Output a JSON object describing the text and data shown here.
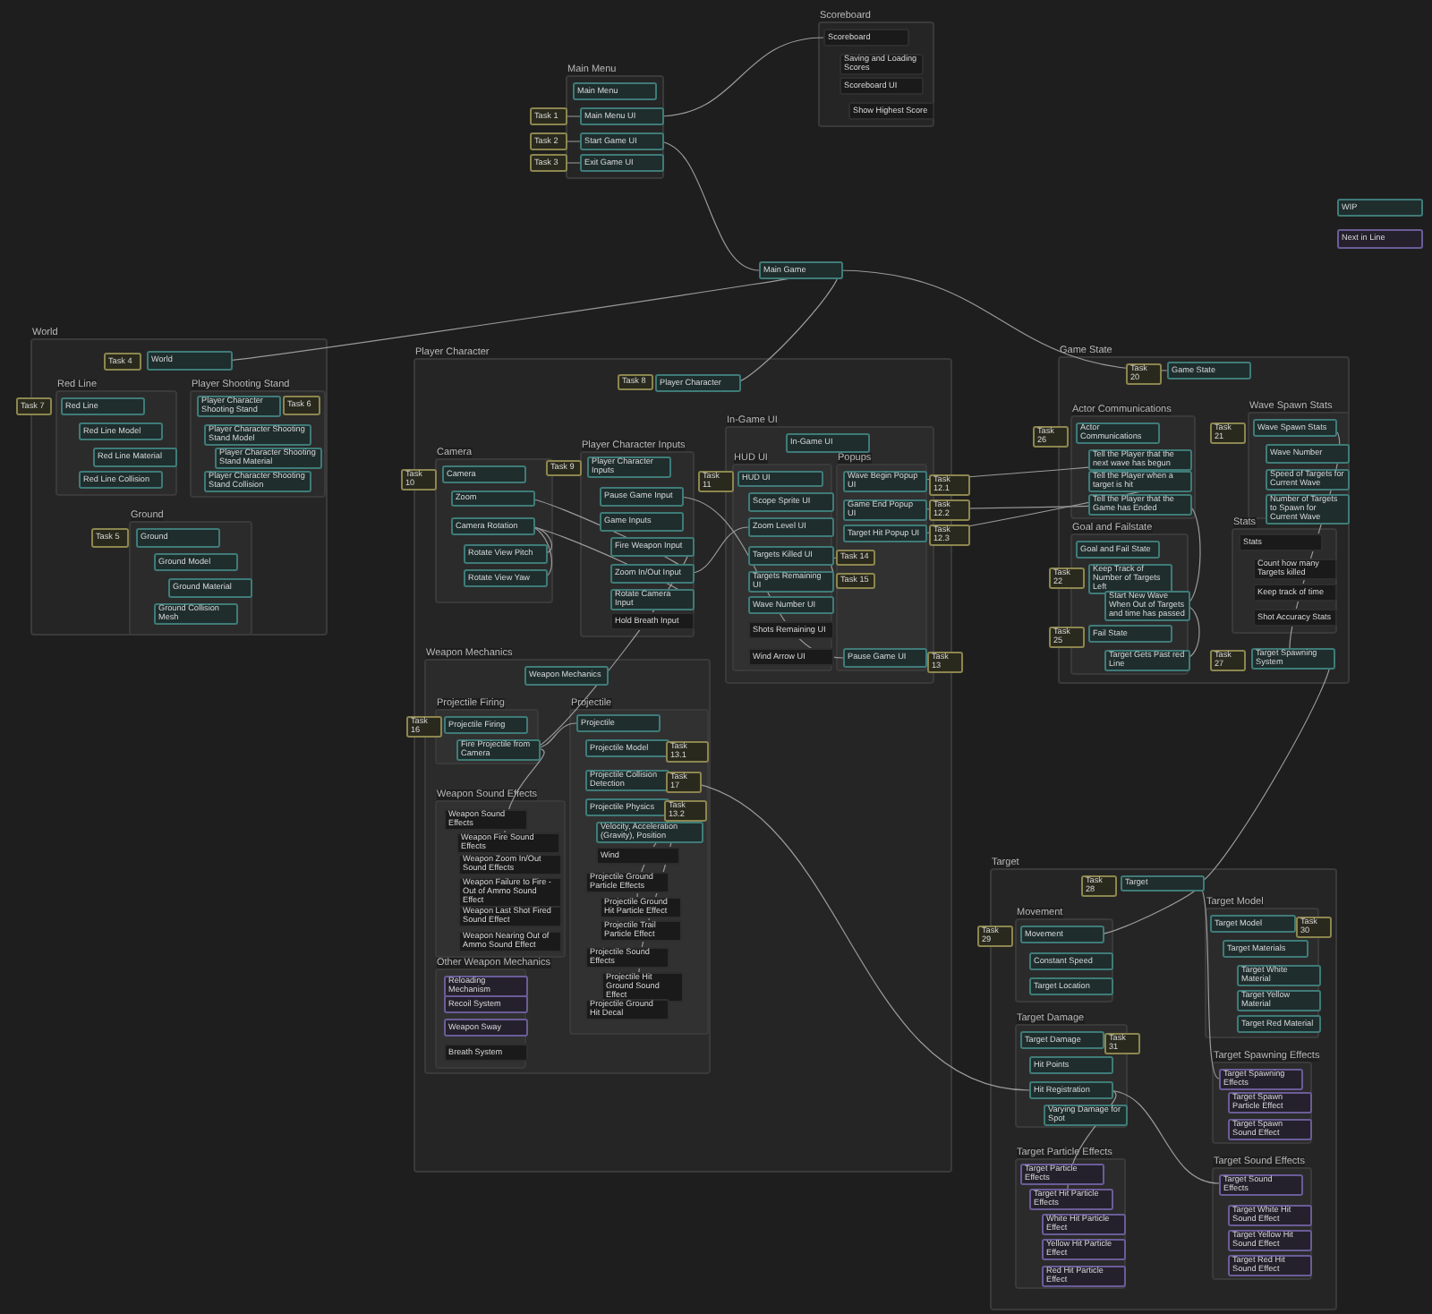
{
  "frames": [
    {
      "title": "Scoreboard"
    },
    {
      "title": "Main Menu"
    },
    {
      "title": "World"
    },
    {
      "title": "Red Line"
    },
    {
      "title": "Player Shooting Stand"
    },
    {
      "title": "Ground"
    },
    {
      "title": "Player Character"
    },
    {
      "title": "Camera"
    },
    {
      "title": "Player Character Inputs"
    },
    {
      "title": "In-Game UI"
    },
    {
      "title": "HUD UI"
    },
    {
      "title": "Popups"
    },
    {
      "title": "Weapon Mechanics"
    },
    {
      "title": "Projectile Firing"
    },
    {
      "title": "Weapon Sound Effects"
    },
    {
      "title": "Other Weapon Mechanics"
    },
    {
      "title": "Projectile"
    },
    {
      "title": "Game State"
    },
    {
      "title": "Actor Communications"
    },
    {
      "title": "Goal and Failstate"
    },
    {
      "title": "Wave Spawn Stats"
    },
    {
      "title": "Stats"
    },
    {
      "title": "Target"
    },
    {
      "title": "Movement"
    },
    {
      "title": "Target Model"
    },
    {
      "title": "Target Damage"
    },
    {
      "title": "Target Spawning Effects"
    },
    {
      "title": "Target Particle Effects"
    },
    {
      "title": "Target Sound Effects"
    }
  ],
  "nodes": [
    {
      "label": "Scoreboard",
      "kind": "todo"
    },
    {
      "label": "Saving and Loading Scores",
      "kind": "todo"
    },
    {
      "label": "Scoreboard UI",
      "kind": "todo"
    },
    {
      "label": "Show Highest Score",
      "kind": "todo"
    },
    {
      "label": "Main Menu",
      "kind": "wip"
    },
    {
      "label": "Task 1",
      "kind": "task"
    },
    {
      "label": "Main Menu UI",
      "kind": "wip"
    },
    {
      "label": "Task 2",
      "kind": "task"
    },
    {
      "label": "Start Game UI",
      "kind": "wip"
    },
    {
      "label": "Task 3",
      "kind": "task"
    },
    {
      "label": "Exit Game UI",
      "kind": "wip"
    },
    {
      "label": "WIP",
      "kind": "wip"
    },
    {
      "label": "Next in Line",
      "kind": "next"
    },
    {
      "label": "Main Game",
      "kind": "wip"
    },
    {
      "label": "Task 4",
      "kind": "task"
    },
    {
      "label": "World",
      "kind": "wip"
    },
    {
      "label": "Task 7",
      "kind": "task"
    },
    {
      "label": "Red Line",
      "kind": "wip"
    },
    {
      "label": "Red Line Model",
      "kind": "wip"
    },
    {
      "label": "Red Line Material",
      "kind": "wip"
    },
    {
      "label": "Red Line Collision",
      "kind": "wip"
    },
    {
      "label": "Player Character Shooting Stand",
      "kind": "wip"
    },
    {
      "label": "Task 6",
      "kind": "task"
    },
    {
      "label": "Player Character Shooting Stand Model",
      "kind": "wip"
    },
    {
      "label": "Player Character Shooting Stand Material",
      "kind": "wip"
    },
    {
      "label": "Player Character Shooting Stand Collision",
      "kind": "wip"
    },
    {
      "label": "Task 5",
      "kind": "task"
    },
    {
      "label": "Ground",
      "kind": "wip"
    },
    {
      "label": "Ground Model",
      "kind": "wip"
    },
    {
      "label": "Ground Material",
      "kind": "wip"
    },
    {
      "label": "Ground Collision Mesh",
      "kind": "wip"
    },
    {
      "label": "Task 8",
      "kind": "task"
    },
    {
      "label": "Player Character",
      "kind": "wip"
    },
    {
      "label": "Task 10",
      "kind": "task"
    },
    {
      "label": "Camera",
      "kind": "wip"
    },
    {
      "label": "Task 9",
      "kind": "task"
    },
    {
      "label": "Zoom",
      "kind": "wip"
    },
    {
      "label": "Camera Rotation",
      "kind": "wip"
    },
    {
      "label": "Rotate View Pitch",
      "kind": "wip"
    },
    {
      "label": "Rotate View Yaw",
      "kind": "wip"
    },
    {
      "label": "Player Character Inputs",
      "kind": "wip"
    },
    {
      "label": "Pause Game Input",
      "kind": "wip"
    },
    {
      "label": "Game Inputs",
      "kind": "wip"
    },
    {
      "label": "Fire Weapon Input",
      "kind": "wip"
    },
    {
      "label": "Zoom In/Out Input",
      "kind": "wip"
    },
    {
      "label": "Rotate Camera Input",
      "kind": "wip"
    },
    {
      "label": "Hold Breath Input",
      "kind": "todo"
    },
    {
      "label": "In-Game UI",
      "kind": "wip"
    },
    {
      "label": "Task 11",
      "kind": "task"
    },
    {
      "label": "HUD UI",
      "kind": "wip"
    },
    {
      "label": "Scope Sprite UI",
      "kind": "wip"
    },
    {
      "label": "Zoom Level UI",
      "kind": "wip"
    },
    {
      "label": "Targets Killed UI",
      "kind": "wip"
    },
    {
      "label": "Targets Remaining UI",
      "kind": "wip"
    },
    {
      "label": "Wave Number UI",
      "kind": "wip"
    },
    {
      "label": "Shots Remaining UI",
      "kind": "todo"
    },
    {
      "label": "Wind Arrow UI",
      "kind": "todo"
    },
    {
      "label": "Wave Begin Popup UI",
      "kind": "wip"
    },
    {
      "label": "Task 12.1",
      "kind": "task"
    },
    {
      "label": "Game End Popup UI",
      "kind": "wip"
    },
    {
      "label": "Task 12.2",
      "kind": "task"
    },
    {
      "label": "Target Hit Popup UI",
      "kind": "wip"
    },
    {
      "label": "Task 12.3",
      "kind": "task"
    },
    {
      "label": "Task 14",
      "kind": "task"
    },
    {
      "label": "Task 15",
      "kind": "task"
    },
    {
      "label": "Pause Game UI",
      "kind": "wip"
    },
    {
      "label": "Task 13",
      "kind": "task"
    },
    {
      "label": "Weapon Mechanics",
      "kind": "wip"
    },
    {
      "label": "Task 16",
      "kind": "task"
    },
    {
      "label": "Projectile Firing",
      "kind": "wip"
    },
    {
      "label": "Fire Projectile from Camera",
      "kind": "wip"
    },
    {
      "label": "Projectile",
      "kind": "wip"
    },
    {
      "label": "Projectile Model",
      "kind": "wip"
    },
    {
      "label": "Task 13.1",
      "kind": "task"
    },
    {
      "label": "Projectile Collision Detection",
      "kind": "wip"
    },
    {
      "label": "Task 17",
      "kind": "task"
    },
    {
      "label": "Projectile Physics",
      "kind": "wip"
    },
    {
      "label": "Task 13.2",
      "kind": "task"
    },
    {
      "label": "Velocity, Acceleration (Gravity), Position",
      "kind": "wip"
    },
    {
      "label": "Wind",
      "kind": "todo"
    },
    {
      "label": "Projectile Ground Particle Effects",
      "kind": "todo"
    },
    {
      "label": "Projectile Ground Hit Particle Effect",
      "kind": "todo"
    },
    {
      "label": "Projectile Trail Particle Effect",
      "kind": "todo"
    },
    {
      "label": "Projectile Sound Effects",
      "kind": "todo"
    },
    {
      "label": "Projectile Hit Ground Sound Effect",
      "kind": "todo"
    },
    {
      "label": "Projectile Ground Hit Decal",
      "kind": "todo"
    },
    {
      "label": "Weapon Sound Effects",
      "kind": "todo"
    },
    {
      "label": "Weapon Fire Sound Effects",
      "kind": "todo"
    },
    {
      "label": "Weapon Zoom In/Out Sound Effects",
      "kind": "todo"
    },
    {
      "label": "Weapon Failure to Fire - Out of Ammo Sound Effect",
      "kind": "todo"
    },
    {
      "label": "Weapon Last Shot Fired Sound Effect",
      "kind": "todo"
    },
    {
      "label": "Weapon Nearing Out of Ammo Sound Effect",
      "kind": "todo"
    },
    {
      "label": "Reloading Mechanism",
      "kind": "next"
    },
    {
      "label": "Recoil System",
      "kind": "next"
    },
    {
      "label": "Weapon Sway",
      "kind": "next"
    },
    {
      "label": "Breath System",
      "kind": "todo"
    },
    {
      "label": "Task 20",
      "kind": "task"
    },
    {
      "label": "Game State",
      "kind": "wip"
    },
    {
      "label": "Task 26",
      "kind": "task"
    },
    {
      "label": "Actor Communications",
      "kind": "wip"
    },
    {
      "label": "Tell the Player that the next wave has begun",
      "kind": "wip"
    },
    {
      "label": "Tell the Player when a target is hit",
      "kind": "wip"
    },
    {
      "label": "Tell the Player that the Game has Ended",
      "kind": "wip"
    },
    {
      "label": "Goal and Fail State",
      "kind": "wip"
    },
    {
      "label": "Task 22",
      "kind": "task"
    },
    {
      "label": "Keep Track of Number of Targets Left",
      "kind": "wip"
    },
    {
      "label": "Start New Wave When Out of Targets and time has passed",
      "kind": "wip"
    },
    {
      "label": "Task 25",
      "kind": "task"
    },
    {
      "label": "Fail State",
      "kind": "wip"
    },
    {
      "label": "Target Gets Past red Line",
      "kind": "wip"
    },
    {
      "label": "Task 21",
      "kind": "task"
    },
    {
      "label": "Wave Spawn Stats",
      "kind": "wip"
    },
    {
      "label": "Wave Number",
      "kind": "wip"
    },
    {
      "label": "Speed of Targets for Current Wave",
      "kind": "wip"
    },
    {
      "label": "Number of Targets to Spawn for Current Wave",
      "kind": "wip"
    },
    {
      "label": "Stats",
      "kind": "todo"
    },
    {
      "label": "Count how many Targets killed",
      "kind": "todo"
    },
    {
      "label": "Keep track of time",
      "kind": "todo"
    },
    {
      "label": "Shot Accuracy Stats",
      "kind": "todo"
    },
    {
      "label": "Task 27",
      "kind": "task"
    },
    {
      "label": "Target Spawning System",
      "kind": "wip"
    },
    {
      "label": "Task 28",
      "kind": "task"
    },
    {
      "label": "Target",
      "kind": "wip"
    },
    {
      "label": "Task 29",
      "kind": "task"
    },
    {
      "label": "Movement",
      "kind": "wip"
    },
    {
      "label": "Constant Speed",
      "kind": "wip"
    },
    {
      "label": "Target Location",
      "kind": "wip"
    },
    {
      "label": "Target Model",
      "kind": "wip"
    },
    {
      "label": "Task 30",
      "kind": "task"
    },
    {
      "label": "Target Materials",
      "kind": "wip"
    },
    {
      "label": "Target White Material",
      "kind": "wip"
    },
    {
      "label": "Target Yellow Material",
      "kind": "wip"
    },
    {
      "label": "Target Red Material",
      "kind": "wip"
    },
    {
      "label": "Target Damage",
      "kind": "wip"
    },
    {
      "label": "Task 31",
      "kind": "task"
    },
    {
      "label": "Hit Points",
      "kind": "wip"
    },
    {
      "label": "Hit Registration",
      "kind": "wip"
    },
    {
      "label": "Varying Damage for Spot",
      "kind": "wip"
    },
    {
      "label": "Target Spawning Effects",
      "kind": "next"
    },
    {
      "label": "Target Spawn Particle Effect",
      "kind": "next"
    },
    {
      "label": "Target Spawn Sound Effect",
      "kind": "next"
    },
    {
      "label": "Target Particle Effects",
      "kind": "next"
    },
    {
      "label": "Target Hit Particle Effects",
      "kind": "next"
    },
    {
      "label": "White Hit Particle Effect",
      "kind": "next"
    },
    {
      "label": "Yellow Hit Particle Effect",
      "kind": "next"
    },
    {
      "label": "Red Hit Particle Effect",
      "kind": "next"
    },
    {
      "label": "Target Sound Effects",
      "kind": "next"
    },
    {
      "label": "Target White Hit Sound Effect",
      "kind": "next"
    },
    {
      "label": "Target Yellow Hit Sound Effect",
      "kind": "next"
    },
    {
      "label": "Target Red Hit Sound Effect",
      "kind": "next"
    }
  ]
}
